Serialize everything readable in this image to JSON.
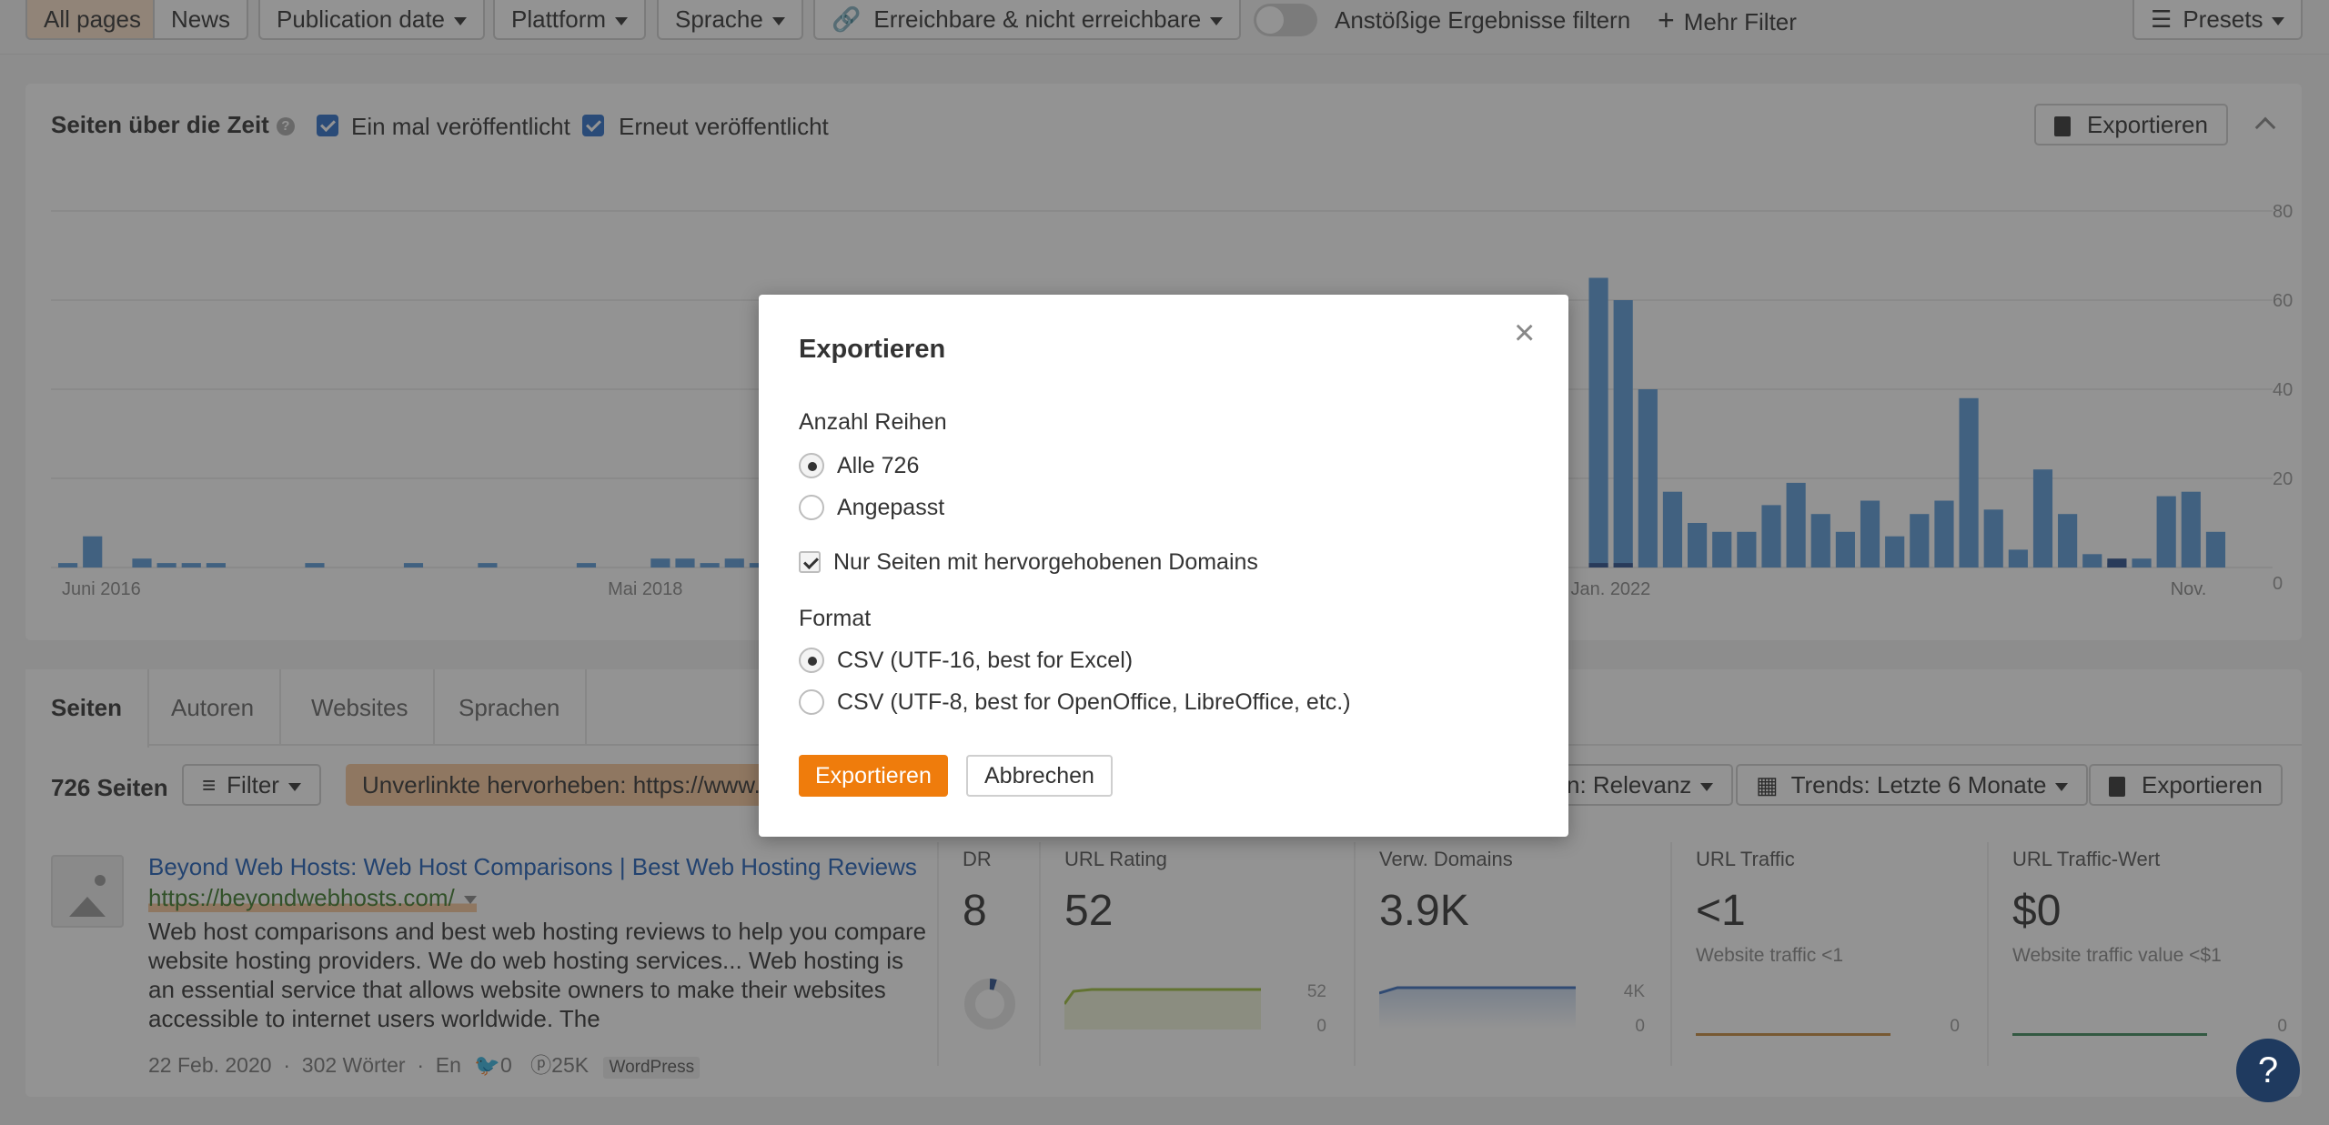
{
  "filters": {
    "seg_all": "All pages",
    "seg_news": "News",
    "publication_date": "Publication date",
    "platform": "Plattform",
    "language": "Sprache",
    "reachable": "Erreichbare & nicht erreichbare",
    "offensive_toggle": "Anstößige Ergebnisse filtern",
    "more_filters": "Mehr Filter",
    "presets": "Presets"
  },
  "chart_card": {
    "title": "Seiten über die Zeit",
    "check1": "Ein mal veröffentlicht",
    "check2": "Erneut veröffentlicht",
    "export": "Exportieren"
  },
  "chart_data": {
    "type": "bar",
    "x_ticks": [
      "Juni 2016",
      "Mai 2018",
      "Jan. 2022",
      "Nov."
    ],
    "y_ticks": [
      0,
      20,
      40,
      60,
      80
    ],
    "ylim": [
      0,
      80
    ],
    "series": [
      {
        "values": [
          1,
          7,
          0,
          2,
          1,
          1,
          1,
          0,
          0,
          0,
          1,
          0,
          0,
          0,
          1,
          0,
          0,
          1,
          0,
          0,
          0,
          1,
          0,
          0,
          2,
          2,
          1,
          2,
          1,
          2,
          2,
          0,
          0,
          0,
          0,
          0,
          0,
          0,
          0,
          0,
          0,
          0,
          0,
          0,
          0,
          0,
          0,
          0,
          0,
          0,
          0,
          0,
          0,
          0,
          0,
          0,
          0,
          0,
          0,
          0,
          0,
          0,
          65,
          60,
          40,
          17,
          10,
          8,
          8,
          14,
          19,
          12,
          8,
          15,
          7,
          12,
          15,
          38,
          13,
          4,
          22,
          12,
          3,
          1,
          2,
          16,
          17,
          8
        ]
      },
      {
        "values": [
          0,
          0,
          0,
          0,
          0,
          0,
          0,
          0,
          0,
          0,
          0,
          0,
          0,
          0,
          0,
          0,
          0,
          0,
          0,
          0,
          0,
          0,
          0,
          0,
          0,
          0,
          0,
          0,
          0,
          0,
          0,
          0,
          0,
          0,
          0,
          0,
          0,
          0,
          0,
          0,
          0,
          0,
          0,
          0,
          0,
          0,
          0,
          0,
          0,
          0,
          0,
          0,
          0,
          0,
          0,
          0,
          0,
          0,
          0,
          0,
          0,
          0,
          1,
          1,
          0,
          0,
          0,
          0,
          0,
          0,
          0,
          0,
          0,
          0,
          0,
          0,
          0,
          0,
          0,
          0,
          0,
          0,
          0,
          2,
          0,
          0,
          0,
          0
        ]
      }
    ],
    "colors": [
      "#5a9ad8",
      "#2a4f8c"
    ]
  },
  "tabs": [
    "Seiten",
    "Autoren",
    "Websites",
    "Sprachen"
  ],
  "list": {
    "count": "726 Seiten",
    "filter": "Filter",
    "highlight": "Unverlinkte hervorheben: https://www.b",
    "sort": "n: Relevanz",
    "trends": "Trends: Letzte 6 Monate",
    "export": "Exportieren"
  },
  "result": {
    "title": "Beyond Web Hosts: Web Host Comparisons | Best Web Hosting Reviews",
    "url": "https://beyondwebhosts.com/",
    "desc": "Web host comparisons and best web hosting reviews to help you compare website hosting providers. We do web hosting services... Web hosting is an essential service that allows website owners to make their websites accessible to internet users worldwide. The",
    "date": "22 Feb. 2020",
    "words": "302 Wörter",
    "lang": "En",
    "twitter": "0",
    "pinterest": "25K",
    "platform": "WordPress",
    "dr_label": "DR",
    "dr": "8",
    "ur_label": "URL Rating",
    "ur": "52",
    "ur_max": "52",
    "ur_min": "0",
    "rd_label": "Verw. Domains",
    "rd": "3.9K",
    "rd_max": "4K",
    "rd_min": "0",
    "ut_label": "URL Traffic",
    "ut": "<1",
    "ut_sub": "Website traffic <1",
    "ut_min": "0",
    "tv_label": "URL Traffic-Wert",
    "tv": "$0",
    "tv_sub": "Website traffic value <$1",
    "tv_min": "0"
  },
  "modal": {
    "title": "Exportieren",
    "rows_label": "Anzahl Reihen",
    "opt_all": "Alle 726",
    "opt_custom": "Angepasst",
    "only_highlighted": "Nur Seiten mit hervorgehobenen Domains",
    "format_label": "Format",
    "fmt1": "CSV (UTF-16, best for Excel)",
    "fmt2": "CSV (UTF-8, best for OpenOffice, LibreOffice, etc.)",
    "export_btn": "Exportieren",
    "cancel_btn": "Abbrechen"
  },
  "help_fab": "?"
}
